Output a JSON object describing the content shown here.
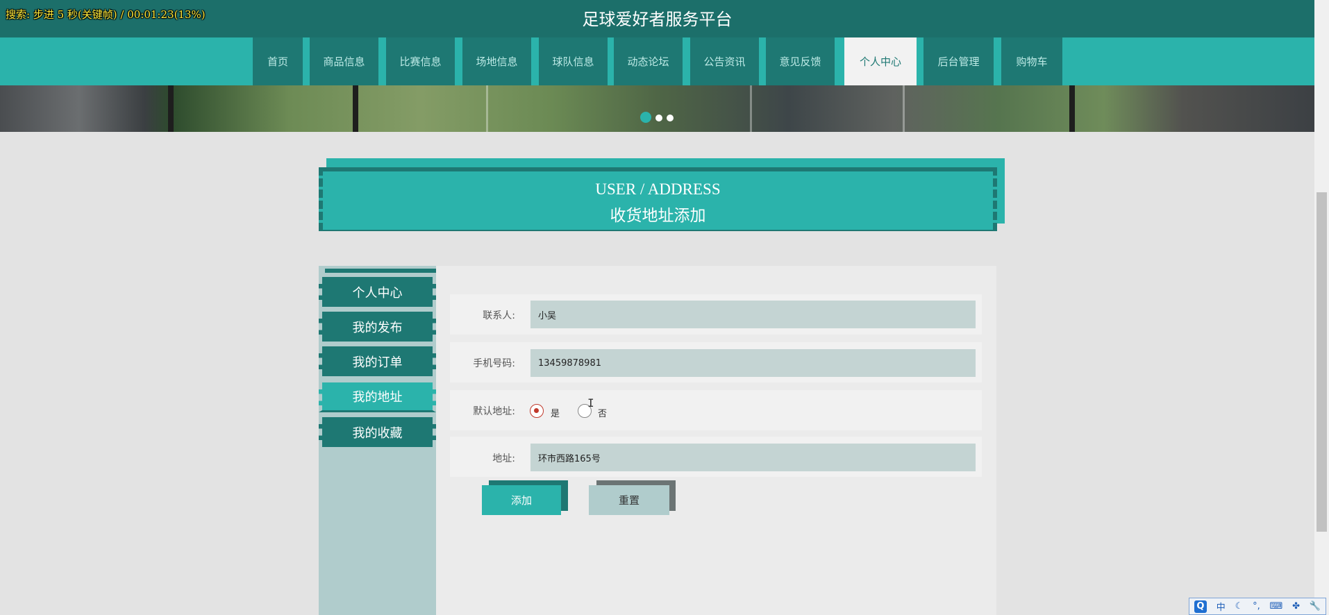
{
  "overlay": {
    "text": "搜索: 步进 5 秒(关键帧) / 00:01:23(13%)"
  },
  "site": {
    "title": "足球爱好者服务平台"
  },
  "nav": {
    "items": [
      {
        "label": "首页"
      },
      {
        "label": "商品信息"
      },
      {
        "label": "比赛信息"
      },
      {
        "label": "场地信息"
      },
      {
        "label": "球队信息"
      },
      {
        "label": "动态论坛"
      },
      {
        "label": "公告资讯"
      },
      {
        "label": "意见反馈"
      },
      {
        "label": "个人中心",
        "active": true
      },
      {
        "label": "后台管理"
      },
      {
        "label": "购物车"
      }
    ]
  },
  "banner": {
    "slides": 3,
    "active_slide": 1
  },
  "heading": {
    "en": "USER / ADDRESS",
    "cn": "收货地址添加"
  },
  "sidebar": {
    "items": [
      {
        "label": "个人中心"
      },
      {
        "label": "我的发布"
      },
      {
        "label": "我的订单"
      },
      {
        "label": "我的地址",
        "active": true
      },
      {
        "label": "我的收藏"
      }
    ]
  },
  "form": {
    "contact": {
      "label": "联系人:",
      "value": "小吴"
    },
    "phone": {
      "label": "手机号码:",
      "value": "13459878981"
    },
    "default_address": {
      "label": "默认地址:",
      "options": [
        "是",
        "否"
      ],
      "selected": "是"
    },
    "address": {
      "label": "地址:",
      "value": "环市西路165号"
    },
    "add_label": "添加",
    "reset_label": "重置"
  },
  "ime": {
    "q": "Q",
    "lang": "中"
  },
  "colors": {
    "primary": "#2bb3ab",
    "dark": "#1e7873",
    "panel": "#b0cccc",
    "input": "#c4d4d3"
  }
}
